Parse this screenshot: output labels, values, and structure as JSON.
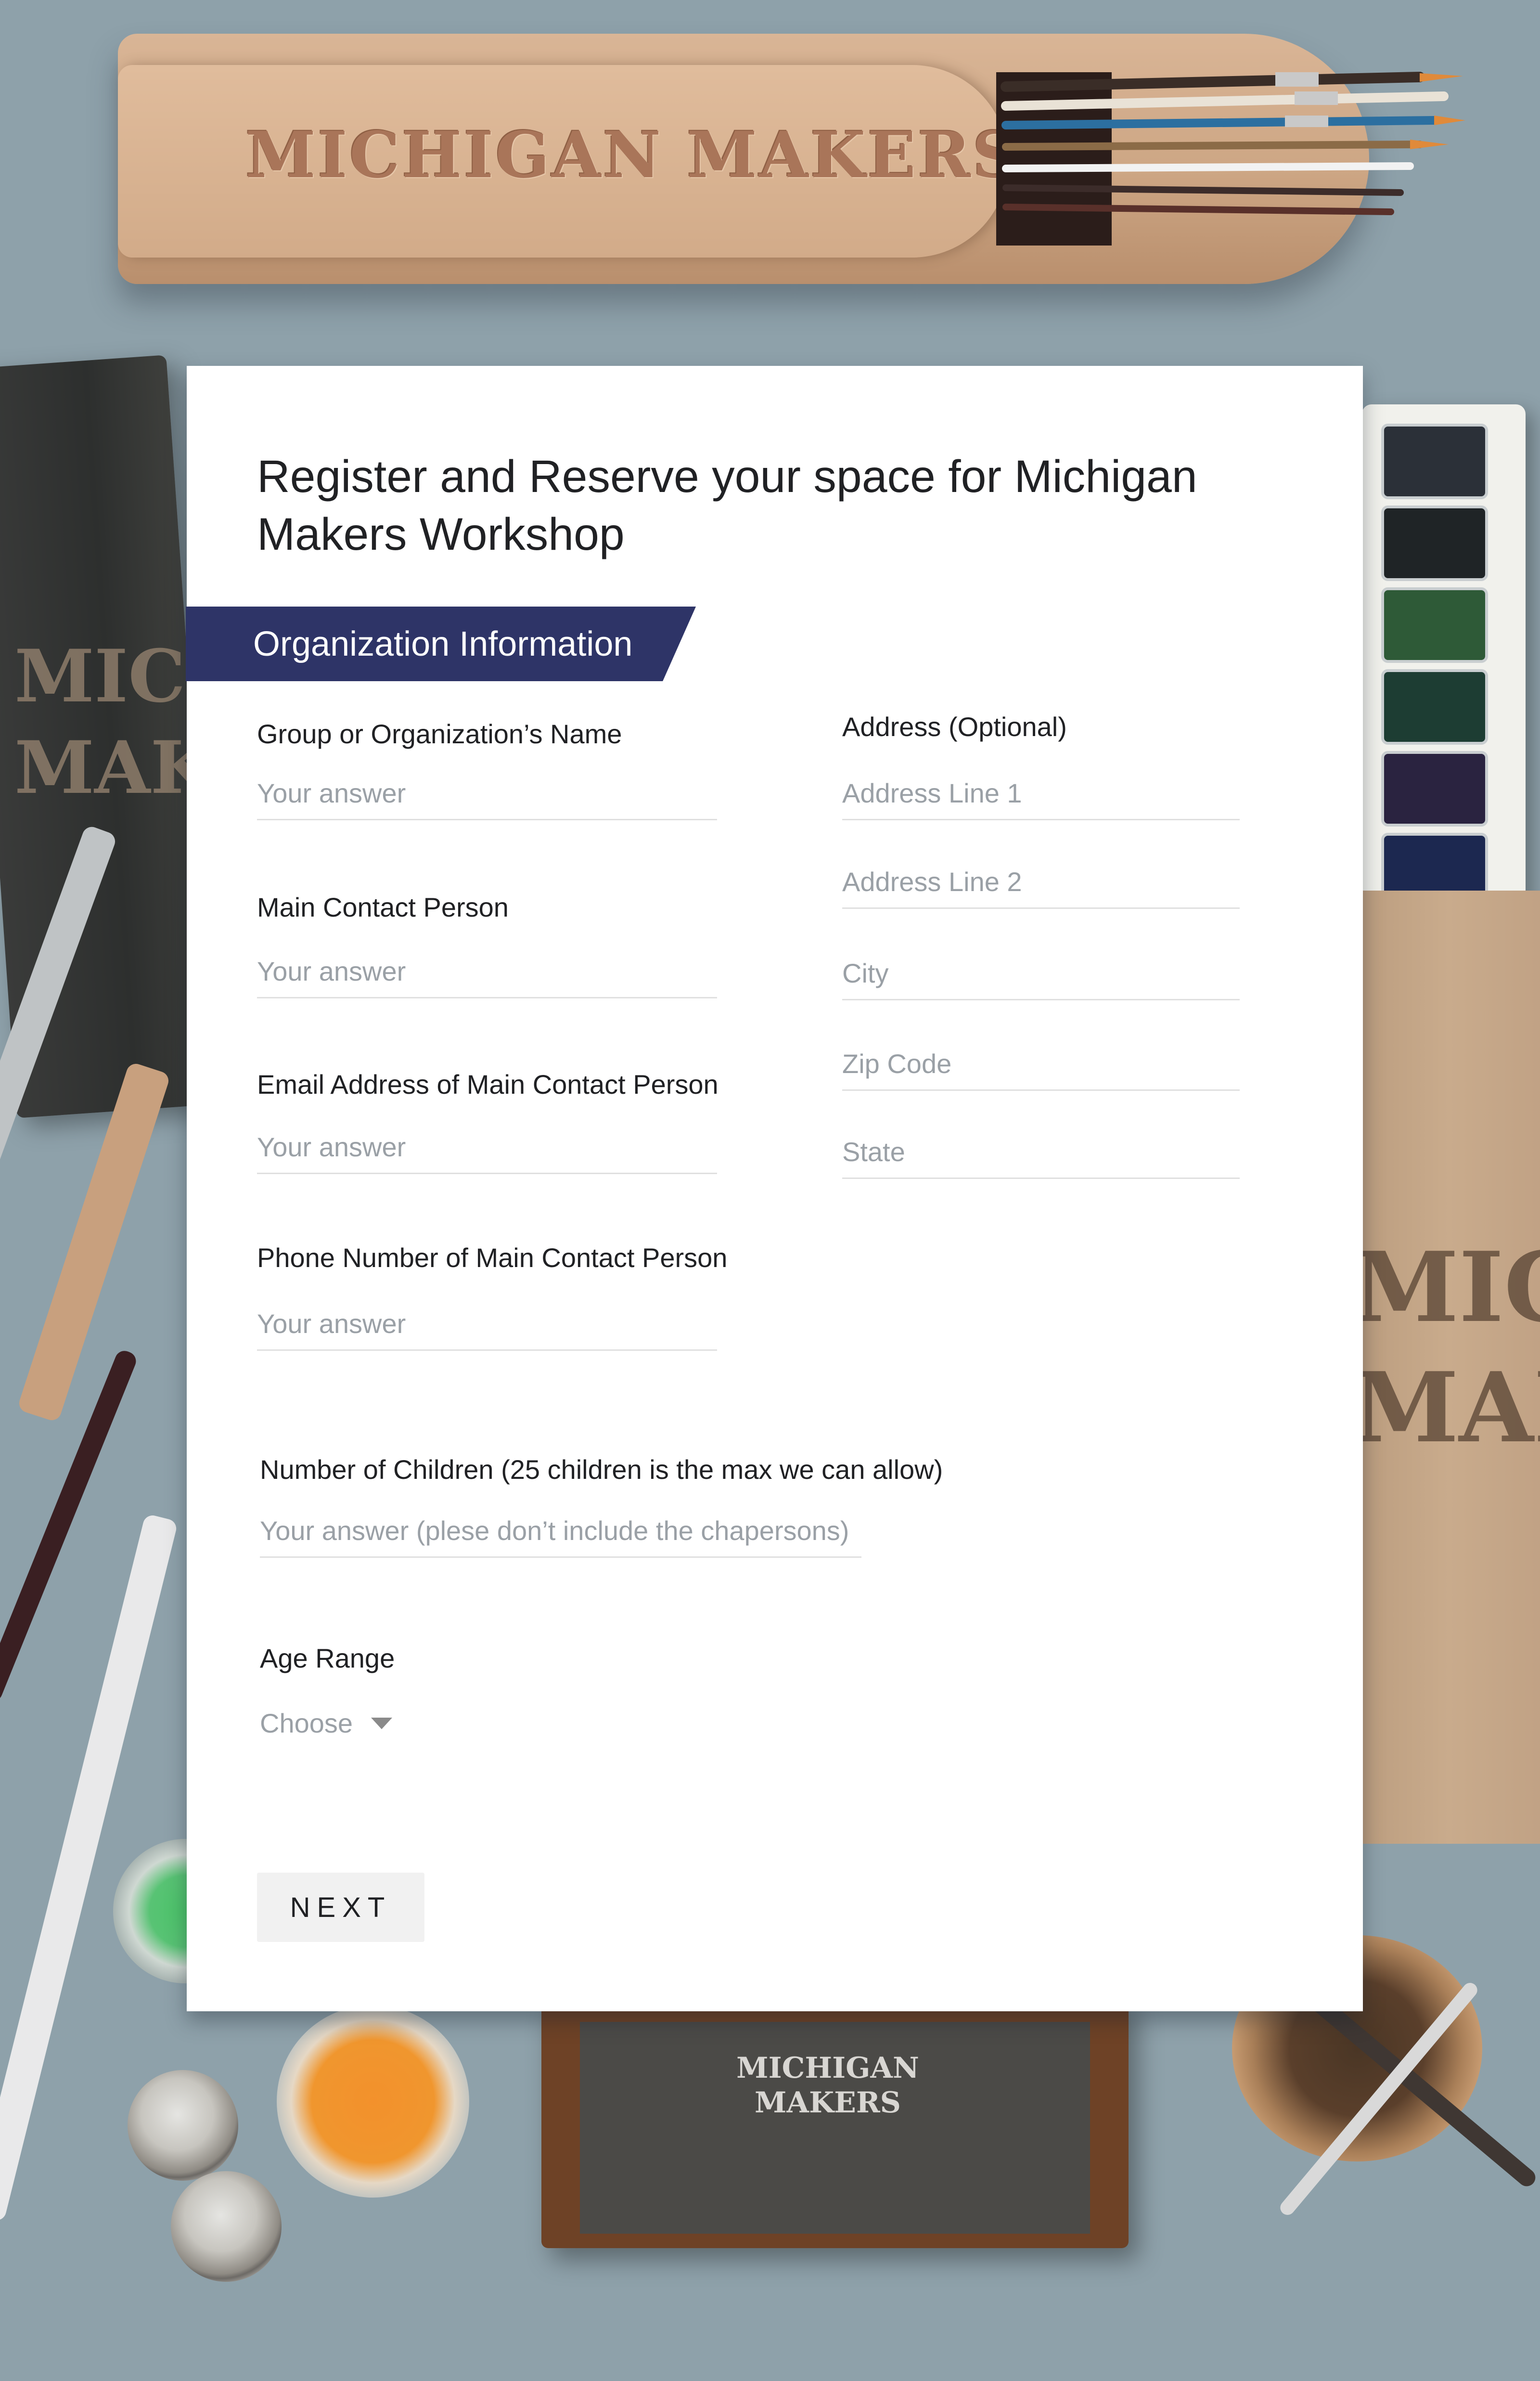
{
  "background": {
    "case_logo": "MICHIGAN MAKERS",
    "book_logo": "MICHIGAN MAKERS",
    "bag_logo": "MICHIGAN MAKERS",
    "slate_logo": "MICHIGAN MAKERS",
    "colors": {
      "backdrop": "#8ea1aa",
      "banner": "#2e3467"
    }
  },
  "form": {
    "title": "Register and Reserve your space for Michigan Makers Workshop",
    "section_title": "Organization Information",
    "left_questions": [
      {
        "label": "Group or Organization’s Name",
        "placeholder": "Your answer"
      },
      {
        "label": "Main Contact Person",
        "placeholder": "Your answer"
      },
      {
        "label": "Email Address of Main Contact Person",
        "placeholder": "Your answer"
      },
      {
        "label": "Phone Number of Main Contact Person",
        "placeholder": "Your answer"
      }
    ],
    "address": {
      "label": "Address (Optional)",
      "fields": [
        "Address Line 1",
        "Address Line 2",
        "City",
        "Zip Code",
        "State"
      ]
    },
    "children": {
      "label": "Number of Children (25 children is the max we can allow)",
      "placeholder": "Your answer (plese don’t include the chapersons)"
    },
    "age_range": {
      "label": "Age Range",
      "selected": "Choose",
      "icon": "dropdown-caret-icon"
    },
    "next_label": "NEXT"
  }
}
